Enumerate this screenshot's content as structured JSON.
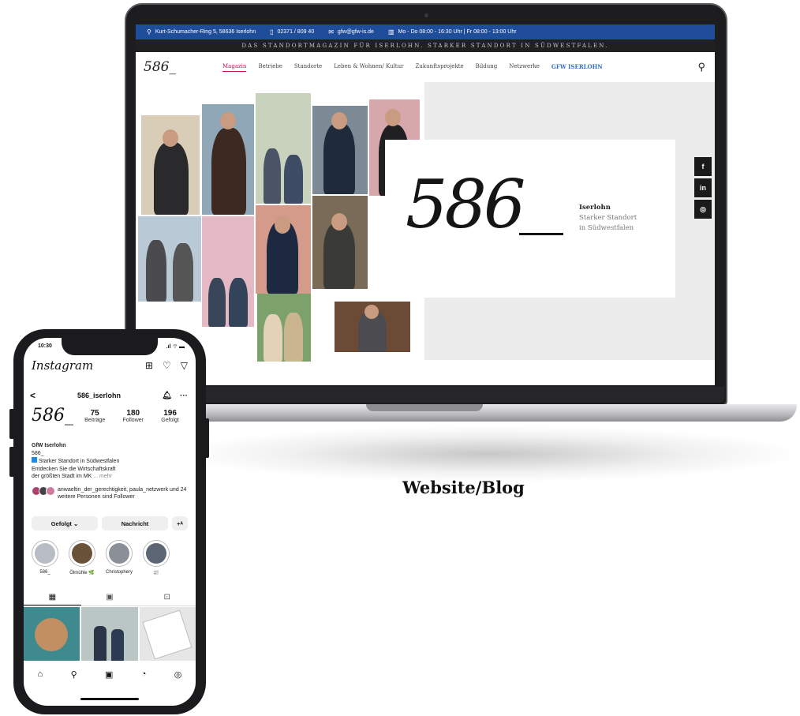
{
  "website": {
    "topbar": {
      "address": "Kurt-Schumacher-Ring 5, 58636 Iserlohn",
      "phone": "02371 / 809 40",
      "email": "gfw@gfw-is.de",
      "hours": "Mo - Do 08:00 - 16:30 Uhr | Fr 08:00 - 13:00 Uhr"
    },
    "tagline": "DAS STANDORTMAGAZIN FÜR ISERLOHN.   STARKER STANDORT IN SÜDWESTFALEN.",
    "nav": {
      "logo": "586_",
      "items": [
        "Magazin",
        "Betriebe",
        "Standorte",
        "Leben & Wohnen/ Kultur",
        "Zukunftsprojekte",
        "Bildung",
        "Netzwerke",
        "GFW ISERLOHN"
      ],
      "active": "Magazin"
    },
    "hero": {
      "logo": "586",
      "city": "Iserlohn",
      "line1": "Starker Standort",
      "line2": "in Südwestfalen"
    },
    "social": [
      "f",
      "in",
      "◎"
    ]
  },
  "caption": "Website/Blog",
  "instagram": {
    "time": "10:30",
    "brand": "Instagram",
    "username": "586_iserlohn",
    "logo": "586_",
    "stats": {
      "posts": "75",
      "posts_label": "Beiträge",
      "followers": "180",
      "followers_label": "Follower",
      "following": "196",
      "following_label": "Gefolgt"
    },
    "bio": {
      "name": "GfW Iserlohn",
      "handle": "586_",
      "line1": "Starker Standort in Südwestfalen",
      "line2": "Entdecken Sie die Wirtschaftskraft",
      "line3": "der größten Stadt im MK",
      "more": "... mehr"
    },
    "followed_by": "anwaeltin_der_gerechtigkeit, paula_netzwerk und 24 weitere Personen sind Follower",
    "buttons": {
      "follow": "Gefolgt ⌄",
      "message": "Nachricht",
      "add": "+ᴬ"
    },
    "stories": [
      "586_",
      "Ölmühle 🌿",
      "Christophery",
      "📰"
    ],
    "colors": {
      "brand_blue": "#1f4d9a",
      "accent_pink": "#c2185b"
    }
  }
}
